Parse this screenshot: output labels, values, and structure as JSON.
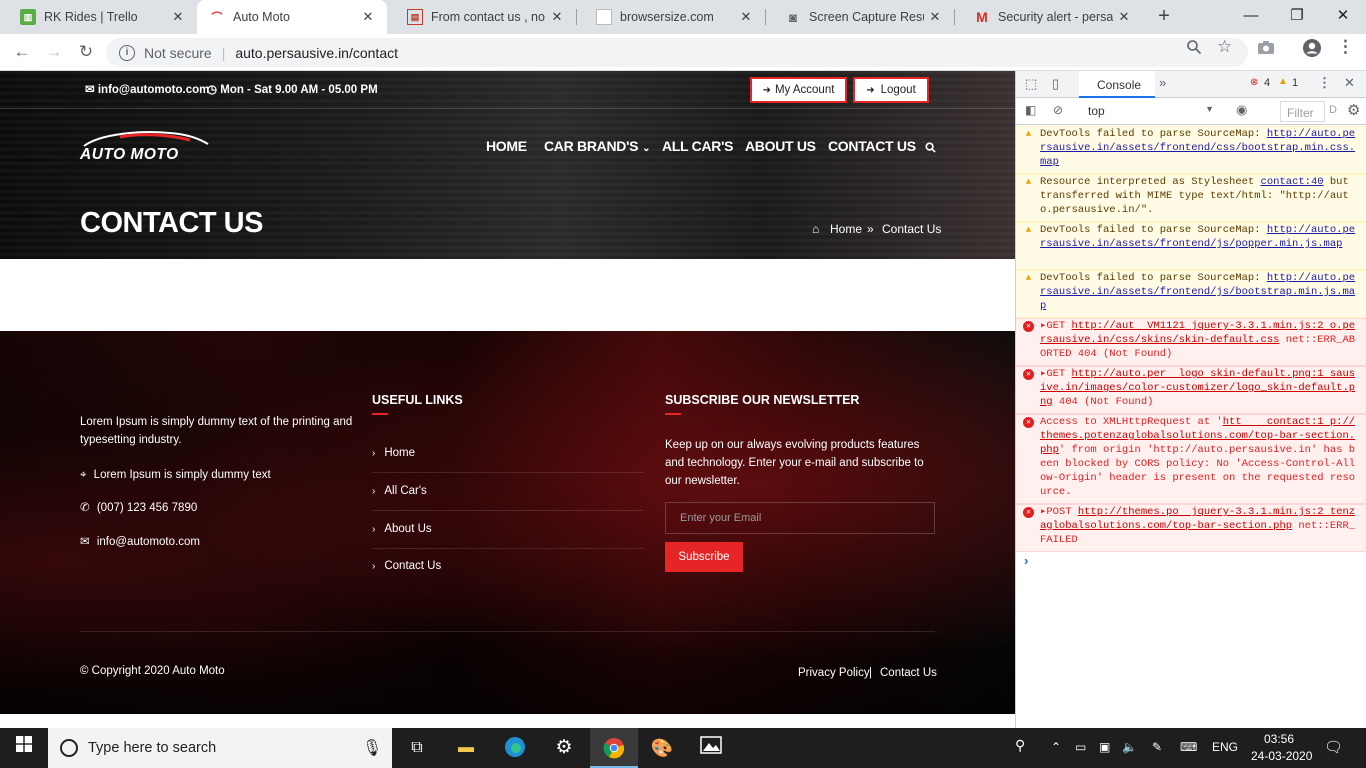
{
  "browser": {
    "tabs": [
      {
        "title": "RK Rides | Trello",
        "favicon": "trello-icon",
        "active": false
      },
      {
        "title": "Auto Moto",
        "favicon": "car-icon",
        "active": true
      },
      {
        "title": "From contact us , no co",
        "favicon": "doc-icon",
        "active": false
      },
      {
        "title": "browsersize.com",
        "favicon": "page-icon",
        "active": false
      },
      {
        "title": "Screen Capture Result",
        "favicon": "camera-icon",
        "active": false
      },
      {
        "title": "Security alert - persausi",
        "favicon": "gmail-icon",
        "active": false
      }
    ],
    "close_symbol": "✕",
    "new_tab": "+",
    "window_controls": {
      "minimize": "—",
      "maximize": "❐",
      "close": "✕"
    },
    "security_label": "Not secure",
    "info_glyph": "i",
    "url": "auto.persausive.in/contact",
    "nav": {
      "back": "←",
      "forward": "→",
      "reload": "↻"
    }
  },
  "site": {
    "topbar": {
      "email": "info@automoto.com",
      "hours": "Mon - Sat 9.00 AM - 05.00 PM",
      "my_account": "My Account",
      "logout": "Logout"
    },
    "logo_text": "AUTO MOTO",
    "nav": [
      "HOME",
      "CAR BRAND'S",
      "ALL CAR'S",
      "ABOUT US",
      "CONTACT US"
    ],
    "page_title": "CONTACT US",
    "breadcrumb": {
      "home": "Home",
      "separator": "»",
      "current": "Contact Us"
    },
    "footer": {
      "about_text": "Lorem Ipsum is simply dummy text of the printing and typesetting industry.",
      "address": "Lorem Ipsum is simply dummy text",
      "phone": "(007) 123 456 7890",
      "email": "info@automoto.com",
      "useful_links_heading": "USEFUL LINKS",
      "useful_links": [
        "Home",
        "All Car's",
        "About Us",
        "Contact Us"
      ],
      "newsletter_heading": "SUBSCRIBE OUR NEWSLETTER",
      "newsletter_text": "Keep up on our always evolving products features and technology. Enter your e-mail and subscribe to our newsletter.",
      "email_placeholder": "Enter your Email",
      "subscribe_label": "Subscribe",
      "copyright": "© Copyright 2020 Auto Moto",
      "privacy": "Privacy Policy",
      "separator": "|",
      "contact": "Contact Us"
    }
  },
  "devtools": {
    "tab": "Console",
    "more": "»",
    "error_count": "4",
    "warning_count": "1",
    "context": "top",
    "filter_placeholder": "Filter",
    "filter_suffix": "D",
    "messages": [
      {
        "level": "warn",
        "text": "DevTools failed to parse SourceMap: ",
        "link": "http://auto.persausive.in/assets/frontend/css/bootstrap.min.css.map"
      },
      {
        "level": "warn",
        "text": "Resource interpreted as Stylesheet ",
        "link": "contact:40",
        "rest": " but transferred with MIME type text/html: \"http://auto.persausive.in/\"."
      },
      {
        "level": "warn",
        "text": "DevTools failed to parse SourceMap: ",
        "link": "http://auto.persausive.in/assets/frontend/js/popper.min.js.map"
      },
      {
        "level": "warn",
        "text": "DevTools failed to parse SourceMap: ",
        "link": "http://auto.persausive.in/assets/frontend/js/bootstrap.min.js.map"
      },
      {
        "level": "err",
        "text": "▸GET ",
        "link": "http://aut  VM1121 jquery-3.3.1.min.js:2 o.persausive.in/css/skins/skin-default.css",
        "rest": " net::ERR_ABORTED 404 (Not Found)"
      },
      {
        "level": "err",
        "text": "▸GET ",
        "link": "http://auto.per  logo skin-default.png:1 sausive.in/images/color-customizer/logo_skin-default.png",
        "rest": " 404 (Not Found)"
      },
      {
        "level": "err",
        "text": "Access to XMLHttpRequest at '",
        "link": "htt    contact:1 p://themes.potenzaglobalsolutions.com/top-bar-section.php",
        "rest": "' from origin 'http://auto.persausive.in' has been blocked by CORS policy: No 'Access-Control-Allow-Origin' header is present on the requested resource."
      },
      {
        "level": "err",
        "text": "▸POST ",
        "link": "http://themes.po  jquery-3.3.1.min.js:2 tenzaglobalsolutions.com/top-bar-section.php",
        "rest": " net::ERR_FAILED"
      }
    ],
    "prompt": "›"
  },
  "taskbar": {
    "search_placeholder": "Type here to search",
    "language": "ENG",
    "time": "03:56",
    "date": "24-03-2020"
  },
  "colors": {
    "accent": "#e62526",
    "brand_dark": "#111111"
  }
}
